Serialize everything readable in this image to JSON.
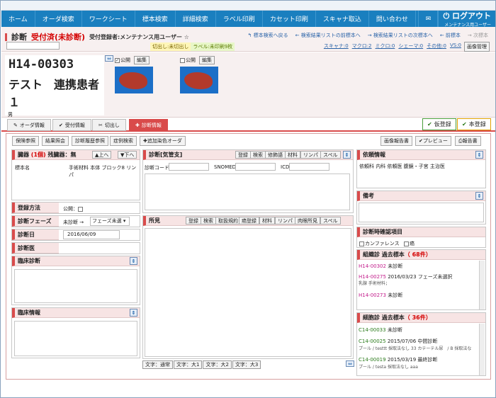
{
  "nav": {
    "items": [
      "ホーム",
      "オーダ検索",
      "ワークシート",
      "標本検索",
      "詳細検索",
      "ラベル印刷",
      "カセット印刷",
      "スキャナ取込",
      "問い合わせ"
    ],
    "logout": "ログアウト",
    "user_sub": "メンテナンス用ユーザー"
  },
  "header": {
    "title": "診断",
    "status": "受付済(未診断)",
    "registrant": "受付登録者:メンテナンス用ユーザー ☆",
    "links": [
      "標本検索へ戻る",
      "検索結果リストの前標本へ",
      "検索結果リストの次標本へ",
      "前標本",
      "次標本"
    ],
    "tag_cut": "切出し:未切出し",
    "tag_label": "ラベル:未印刷9枚",
    "stats": [
      "スキャナ:0",
      "マクロ:2",
      "ミクロ:0",
      "シェーマ:0",
      "その他:0",
      "VS:0"
    ],
    "image_mgr": "画像管理"
  },
  "patient": {
    "id": "H14-00303",
    "name1": "テスト　連携患者",
    "name2": "１",
    "sex": "男"
  },
  "thumbs": [
    {
      "public": "公開",
      "edit": "編集",
      "checked": true
    },
    {
      "public": "公開",
      "edit": "編集",
      "checked": false
    }
  ],
  "tabs": [
    "オーダ情報",
    "受付情報",
    "切出し",
    "診断情報"
  ],
  "actions": {
    "temp_register": "仮登録",
    "register": "本登録"
  },
  "toolbar": {
    "buttons": [
      "保険参照",
      "結果照会",
      "診断履歴参照",
      "症例検索",
      "追加染色オーダ"
    ],
    "report": "画像報告書",
    "preview": "プレビュー",
    "print": "報告書"
  },
  "organ": {
    "title": "臓器",
    "count": "(1個)",
    "remain": "残臓器：無",
    "up": "上へ",
    "down": "下へ",
    "row_label": "標本名",
    "row_value": "手術材料 本体 ブロック8 リンパ"
  },
  "diag_code": {
    "title": "診断[気管支]",
    "btns": [
      "登録",
      "検索",
      "修飾語",
      "材料",
      "リンパ",
      "スペル"
    ],
    "code": "診断コード",
    "snomed": "SNOMED",
    "icd": "ICD"
  },
  "reg_method": {
    "label": "登録方法",
    "public": "公開："
  },
  "phase": {
    "label": "診断フェーズ",
    "from": "未診断 →",
    "select": "フェーズ未選"
  },
  "date": {
    "label": "診断日",
    "value": "2016/06/09"
  },
  "doctor": {
    "label": "診断医"
  },
  "clinical_dx": {
    "label": "臨床診断"
  },
  "clinical_info": {
    "label": "臨床情報"
  },
  "findings": {
    "title": "所見",
    "btns": [
      "登録",
      "検索",
      "取扱規約",
      "癌登録",
      "材料",
      "リンパ",
      "肉眼所見",
      "スペル"
    ],
    "sizes": [
      "文字：通常",
      "文字：大1",
      "文字：大2",
      "文字：大3"
    ]
  },
  "request": {
    "title": "依頼情報",
    "text": "依頼科 内科 依頼医 腹鏡・子宮 主治医"
  },
  "note": {
    "title": "備考"
  },
  "confirm": {
    "title": "診断時確認項目",
    "conf": "カンファレンス",
    "cancer": "癌"
  },
  "tissue": {
    "title": "組織診 過去標本",
    "count": "（ 68件）",
    "items": [
      {
        "id": "H14-00302",
        "text": "未診断",
        "sub": ""
      },
      {
        "id": "H14-00275",
        "text": "2016/03/23 フェーズ未選択",
        "sub": "乳腺 手術材料；"
      },
      {
        "id": "H14-00273",
        "text": "未診断",
        "sub": ""
      }
    ]
  },
  "cyto": {
    "title": "細胞診 過去標本",
    "count": "（ 36件）",
    "items": [
      {
        "id": "C14-00033",
        "text": "未診断",
        "sub": ""
      },
      {
        "id": "C14-00025",
        "text": "2015/07/06 中間診断",
        "sub": "プール / testtt 採取法なし 33 カテーテル尿　/ B 採取法な"
      },
      {
        "id": "C14-00019",
        "text": "2015/03/19 最終診断",
        "sub": "プール / testa 採取法なし aaa"
      }
    ]
  }
}
